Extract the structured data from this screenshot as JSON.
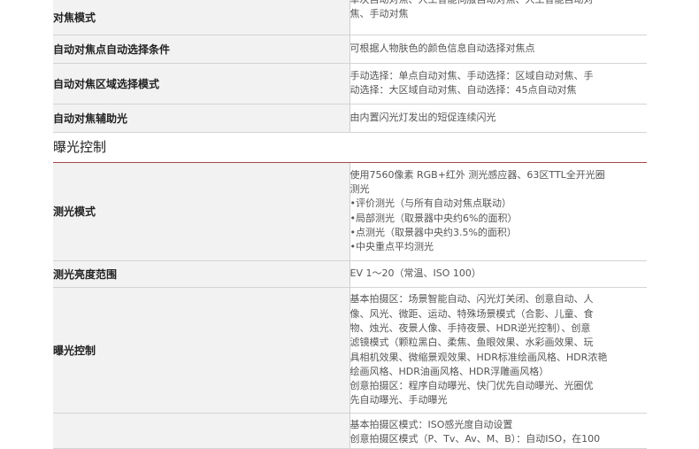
{
  "sections": [
    {
      "title": "",
      "rows": [
        {
          "label": "对焦模式",
          "lines": [
            "单次自动对焦、人工智能伺服自动对焦、人工智能自动对",
            "焦、手动对焦"
          ]
        },
        {
          "label": "自动对焦点自动选择条件",
          "lines": [
            "可根据人物肤色的颜色信息自动选择对焦点"
          ]
        },
        {
          "label": "自动对焦区域选择模式",
          "lines": [
            "手动选择：单点自动对焦、手动选择：区域自动对焦、手",
            "动选择：大区域自动对焦、自动选择：45点自动对焦"
          ]
        },
        {
          "label": "自动对焦辅助光",
          "lines": [
            "由内置闪光灯发出的短促连续闪光"
          ]
        }
      ]
    },
    {
      "title": "曝光控制",
      "rows": [
        {
          "label": "测光模式",
          "lines": [
            "使用7560像素 RGB+红外 测光感应器、63区TTL全开光圈",
            "测光",
            "•评价测光（与所有自动对焦点联动）",
            "•局部测光（取景器中央约6%的面积）",
            "•点测光（取景器中央约3.5%的面积）",
            "•中央重点平均测光"
          ]
        },
        {
          "label": "测光亮度范围",
          "lines": [
            "EV 1～20（常温、ISO 100）"
          ]
        },
        {
          "label": "曝光控制",
          "lines": [
            "基本拍摄区：场景智能自动、闪光灯关闭、创意自动、人",
            "像、风光、微距、运动、特殊场景模式（合影、儿童、食",
            "物、烛光、夜景人像、手持夜景、HDR逆光控制）、创意",
            "滤镜模式（颗粒黑白、柔焦、鱼眼效果、水彩画效果、玩",
            "具相机效果、微缩景观效果、HDR标准绘画风格、HDR浓艳",
            "绘画风格、HDR油画风格、HDR浮雕画风格）",
            "创意拍摄区：程序自动曝光、快门优先自动曝光、光圈优",
            "先自动曝光、手动曝光"
          ]
        },
        {
          "label": "",
          "lines": [
            "基本拍摄区模式：ISO感光度自动设置",
            "创意拍摄区模式（P、Tv、Av、M、B）：自动ISO，在100"
          ]
        }
      ]
    }
  ]
}
